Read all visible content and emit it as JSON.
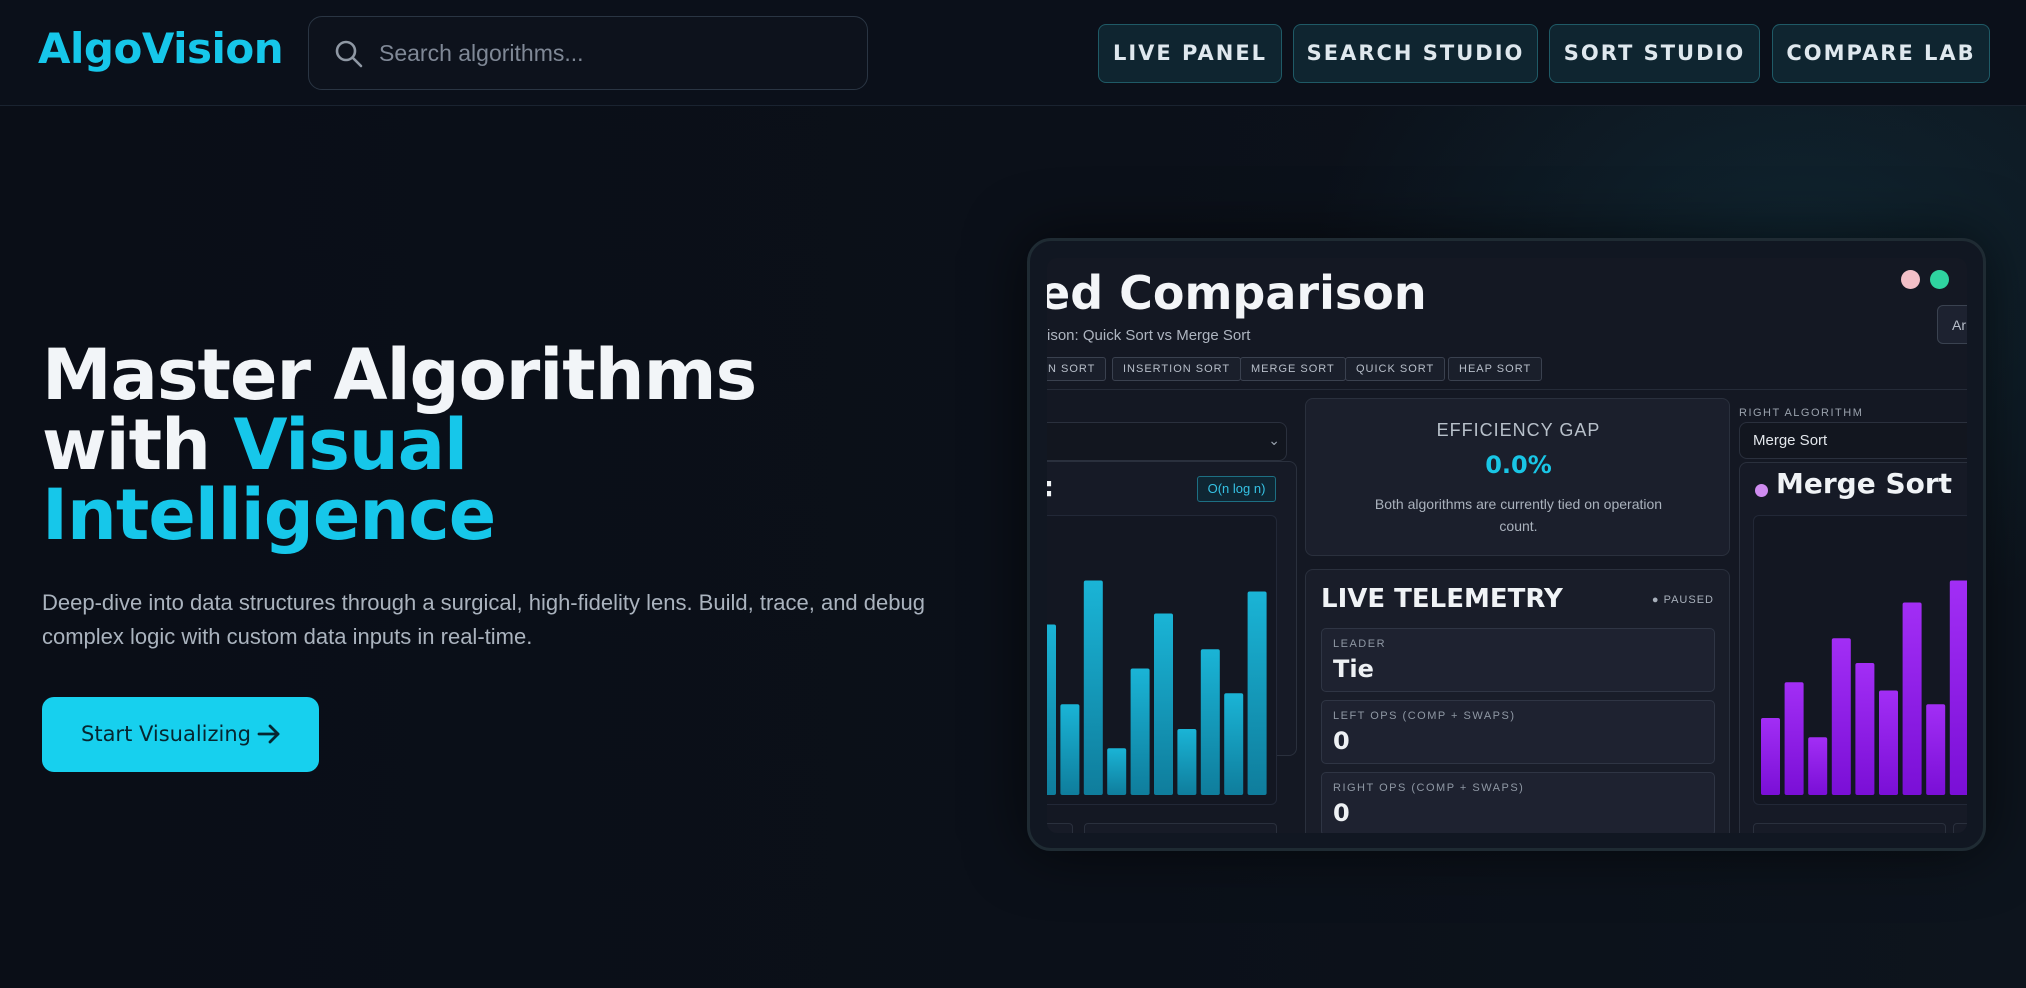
{
  "header": {
    "logo": "AlgoVision",
    "search": {
      "placeholder": "Search algorithms..."
    },
    "nav": [
      {
        "label": "LIVE PANEL"
      },
      {
        "label": "SEARCH STUDIO"
      },
      {
        "label": "SORT STUDIO"
      },
      {
        "label": "COMPARE LAB"
      }
    ]
  },
  "hero": {
    "title_line1": "Master Algorithms",
    "title_line2_prefix": "with ",
    "title_line2_accent": "Visual",
    "title_line3": "Intelligence",
    "subtitle_line1": "Deep-dive into data structures through a surgical, high-fidelity lens. Build, trace, and debug",
    "subtitle_line2": "complex logic with custom data inputs in real-time.",
    "cta_label": "Start Visualizing"
  },
  "preview": {
    "title": "ed Comparison",
    "subtitle": "ison: Quick Sort vs Merge Sort",
    "chips": [
      "N SORT",
      "INSERTION SORT",
      "MERGE SORT",
      "QUICK SORT",
      "HEAP SORT"
    ],
    "array_button": "Array S",
    "window_dots": [
      "#f3c0c8",
      "#2fd4a0"
    ],
    "left": {
      "title_fragment": ":",
      "complexity": "O(n log n)",
      "bars": [
        0.62,
        0.33,
        0.78,
        0.17,
        0.46,
        0.66,
        0.24,
        0.53,
        0.37,
        0.74
      ],
      "color": "#19a6c8"
    },
    "efficiency": {
      "label": "EFFICIENCY GAP",
      "value": "0.0%",
      "note": "Both algorithms are currently tied on operation count."
    },
    "telemetry": {
      "title": "LIVE TELEMETRY",
      "status": "● PAUSED",
      "stats": [
        {
          "label": "LEADER",
          "value": "Tie"
        },
        {
          "label": "LEFT OPS (COMP + SWAPS)",
          "value": "0"
        },
        {
          "label": "RIGHT OPS (COMP + SWAPS)",
          "value": "0"
        }
      ]
    },
    "right": {
      "section_label": "RIGHT ALGORITHM",
      "select_value": "Merge Sort",
      "title": "Merge Sort",
      "bars": [
        0.28,
        0.41,
        0.21,
        0.57,
        0.48,
        0.38,
        0.7,
        0.33,
        0.78
      ],
      "color": "#9a1ff0"
    }
  }
}
